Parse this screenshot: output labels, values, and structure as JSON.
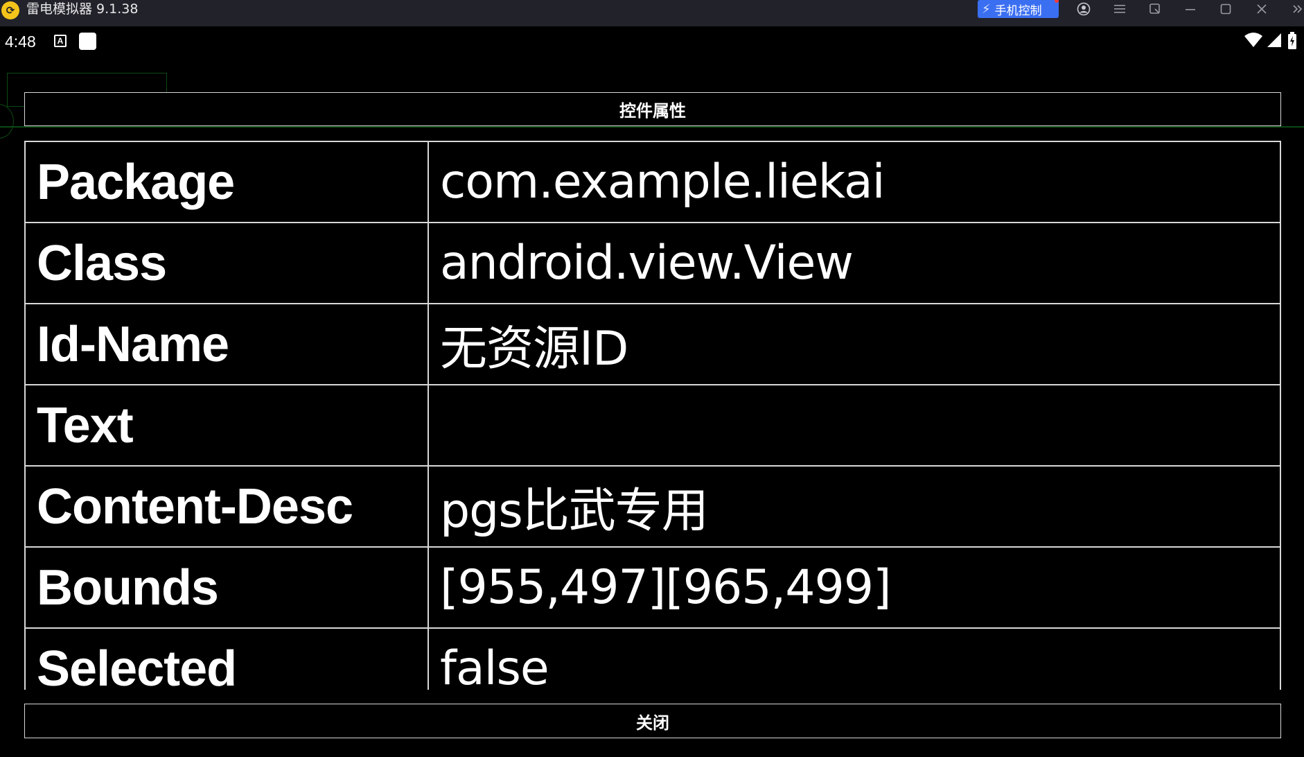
{
  "window": {
    "app_title": "雷电模拟器 9.1.38",
    "logo_glyph": "⟳",
    "phone_control_label": "手机控制"
  },
  "statusbar": {
    "time": "4:48",
    "a_badge": "A"
  },
  "dialog": {
    "title": "控件属性",
    "close_label": "关闭",
    "properties": [
      {
        "key": "Package",
        "value": "com.example.liekai"
      },
      {
        "key": "Class",
        "value": "android.view.View"
      },
      {
        "key": "Id-Name",
        "value": "无资源ID"
      },
      {
        "key": "Text",
        "value": ""
      },
      {
        "key": "Content-Desc",
        "value": "pgs比武专用"
      },
      {
        "key": "Bounds",
        "value": "[955,497][965,499]"
      },
      {
        "key": "Selected",
        "value": "false"
      }
    ]
  },
  "colors": {
    "titlebar_bg": "#22232a",
    "accent": "#3b6ff2",
    "background": "#000000",
    "border": "#d8d8d8",
    "overlay_outline": "#0d4a14"
  },
  "icons": {
    "titlebar": [
      "lightning-icon",
      "user-icon",
      "menu-icon",
      "rotate-icon",
      "minimize-icon",
      "maximize-icon",
      "close-icon",
      "collapse-icon"
    ],
    "statusbar": [
      "wifi-icon",
      "signal-icon",
      "battery-icon"
    ]
  }
}
